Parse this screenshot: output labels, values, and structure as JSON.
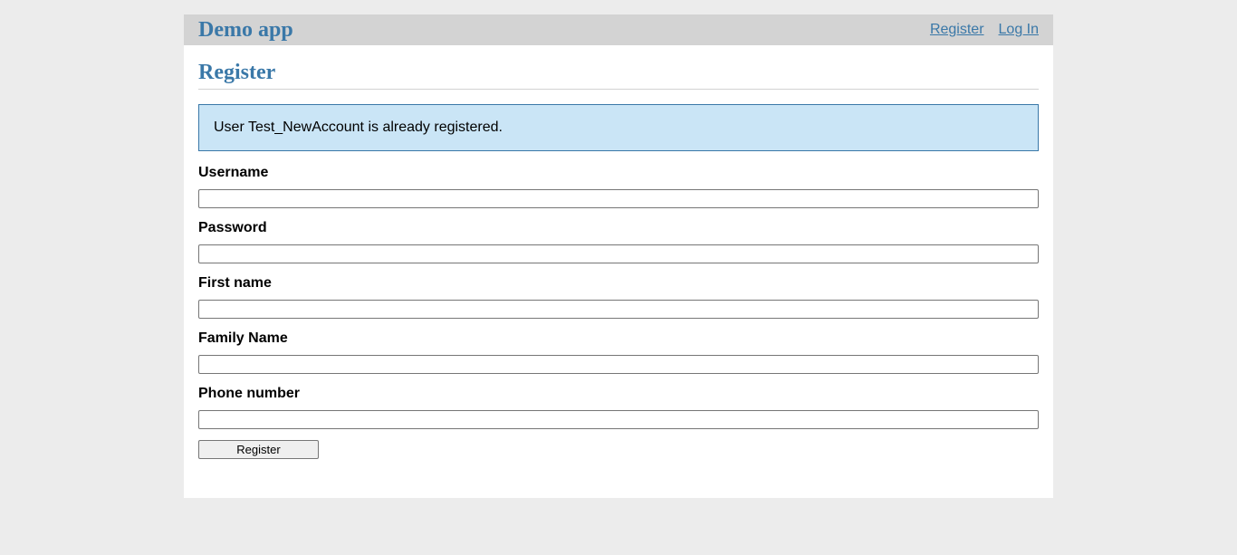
{
  "header": {
    "brand": "Demo app",
    "nav": {
      "register_label": "Register",
      "login_label": "Log In"
    }
  },
  "main": {
    "title": "Register",
    "flash_message": "User Test_NewAccount is already registered.",
    "form": {
      "fields": [
        {
          "label": "Username",
          "value": "",
          "placeholder": ""
        },
        {
          "label": "Password",
          "value": "",
          "placeholder": ""
        },
        {
          "label": "First name",
          "value": "",
          "placeholder": ""
        },
        {
          "label": "Family Name",
          "value": "",
          "placeholder": ""
        },
        {
          "label": "Phone number",
          "value": "",
          "placeholder": ""
        }
      ],
      "submit_label": "Register"
    }
  },
  "colors": {
    "page_background": "#ececec",
    "header_background": "#d3d3d3",
    "accent": "#3a78a8",
    "flash_background": "#cae5f6"
  }
}
